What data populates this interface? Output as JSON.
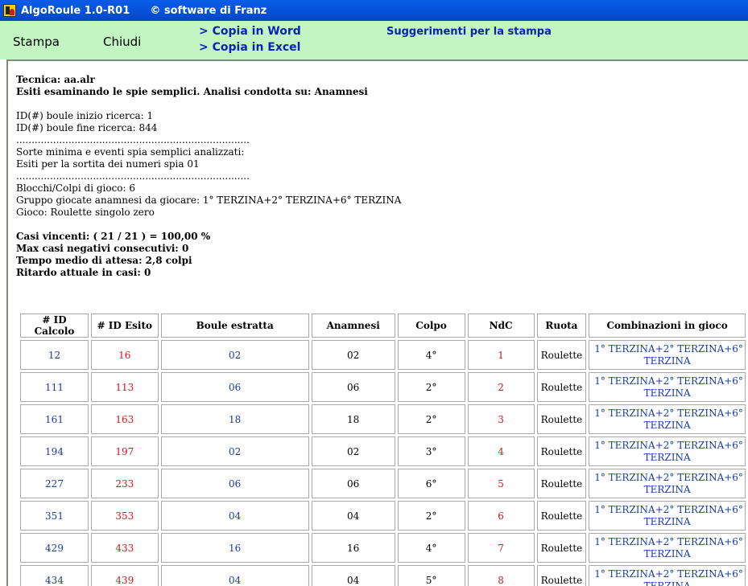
{
  "window": {
    "title": "AlgoRoule 1.0-R01",
    "copyright": "© software di Franz"
  },
  "toolbar": {
    "print_label": "Stampa",
    "close_label": "Chiudi",
    "copy_word_label": "> Copia in Word",
    "copy_excel_label": "> Copia in Excel",
    "print_hints_label": "Suggerimenti per la stampa"
  },
  "report": {
    "technique": "Tecnica: aa.alr",
    "analysis": "Esiti esaminando le spie semplici. Analisi condotta su: Anamnesi",
    "id_start": "ID(#) boule inizio ricerca: 1",
    "id_end": "ID(#) boule fine ricerca: 844",
    "separator": "............................................................................",
    "min_draw": "Sorte minima e eventi spia semplici analizzati:",
    "draw_results": "Esiti per la sortita dei numeri spia 01",
    "blocks": "Blocchi/Colpi di gioco: 6",
    "group": "Gruppo giocate anamnesi da giocare: 1° TERZINA+2° TERZINA+6° TERZINA",
    "game": "Gioco: Roulette singolo zero",
    "winning": "Casi vincenti: ( 21 / 21 ) = 100,00 %",
    "max_negative": "Max casi negativi consecutivi: 0",
    "avg_wait": "Tempo medio di attesa: 2,8 colpi",
    "current_delay": "Ritardo attuale in casi: 0"
  },
  "table": {
    "headers": [
      "# ID Calcolo",
      "# ID Esito",
      "Boule estratta",
      "Anamnesi",
      "Colpo",
      "NdC",
      "Ruota",
      "Combinazioni in gioco"
    ],
    "rows": [
      {
        "id_calc": "12",
        "id_esito": "16",
        "boule": "02",
        "anamnesi": "02",
        "colpo": "4°",
        "ndc": "1",
        "ruota": "Roulette",
        "comb1": "1° TERZINA+2° TERZINA+6°",
        "comb2": "TERZINA"
      },
      {
        "id_calc": "111",
        "id_esito": "113",
        "boule": "06",
        "anamnesi": "06",
        "colpo": "2°",
        "ndc": "2",
        "ruota": "Roulette",
        "comb1": "1° TERZINA+2° TERZINA+6°",
        "comb2": "TERZINA"
      },
      {
        "id_calc": "161",
        "id_esito": "163",
        "boule": "18",
        "anamnesi": "18",
        "colpo": "2°",
        "ndc": "3",
        "ruota": "Roulette",
        "comb1": "1° TERZINA+2° TERZINA+6°",
        "comb2": "TERZINA"
      },
      {
        "id_calc": "194",
        "id_esito": "197",
        "boule": "02",
        "anamnesi": "02",
        "colpo": "3°",
        "ndc": "4",
        "ruota": "Roulette",
        "comb1": "1° TERZINA+2° TERZINA+6°",
        "comb2": "TERZINA"
      },
      {
        "id_calc": "227",
        "id_esito": "233",
        "boule": "06",
        "anamnesi": "06",
        "colpo": "6°",
        "ndc": "5",
        "ruota": "Roulette",
        "comb1": "1° TERZINA+2° TERZINA+6°",
        "comb2": "TERZINA"
      },
      {
        "id_calc": "351",
        "id_esito": "353",
        "boule": "04",
        "anamnesi": "04",
        "colpo": "2°",
        "ndc": "6",
        "ruota": "Roulette",
        "comb1": "1° TERZINA+2° TERZINA+6°",
        "comb2": "TERZINA"
      },
      {
        "id_calc": "429",
        "id_esito": "433",
        "boule": "16",
        "anamnesi": "16",
        "colpo": "4°",
        "ndc": "7",
        "ruota": "Roulette",
        "comb1": "1° TERZINA+2° TERZINA+6°",
        "comb2": "TERZINA"
      },
      {
        "id_calc": "434",
        "id_esito": "439",
        "boule": "04",
        "anamnesi": "04",
        "colpo": "5°",
        "ndc": "8",
        "ruota": "Roulette",
        "comb1": "1° TERZINA+2° TERZINA+6°",
        "comb2": "TERZINA"
      }
    ]
  },
  "colors": {
    "titlebar": "#0550d6",
    "toolbar_bg": "#c2f5c2",
    "link": "#0a22b8",
    "value_blue": "#1c3aa8",
    "value_red": "#d01818"
  },
  "icons": {
    "app": "app-icon"
  }
}
